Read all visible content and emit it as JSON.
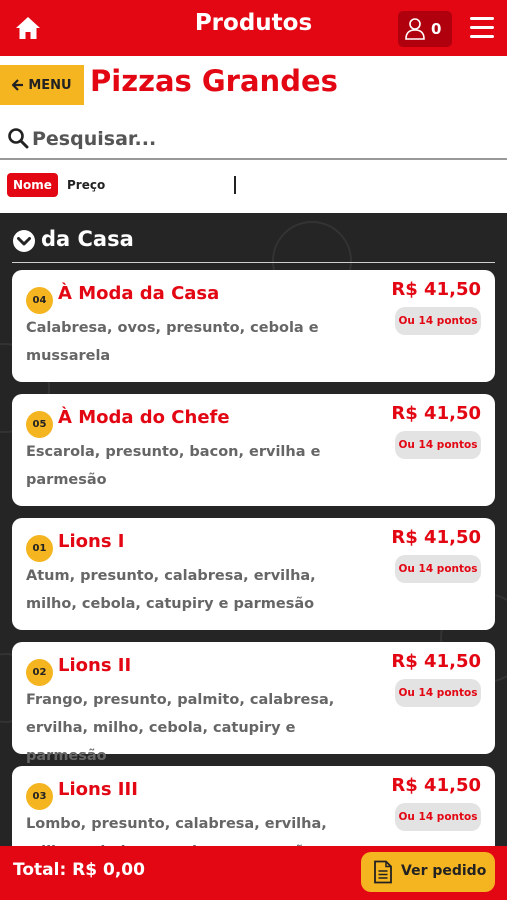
{
  "header": {
    "title": "Produtos",
    "cart_count": "0",
    "brand_color": "#e30613"
  },
  "menu_button": {
    "label": "MENU"
  },
  "page_title": "Pizzas Grandes",
  "search": {
    "placeholder": "Pesquisar...",
    "value": ""
  },
  "sort": {
    "active": "Nome",
    "other": "Preço"
  },
  "section": {
    "title": "da Casa"
  },
  "products": [
    {
      "code": "04",
      "name": "À Moda da Casa",
      "description": "Calabresa, ovos, presunto, cebola e mussarela",
      "price": "R$ 41,50",
      "points": "Ou 14 pontos"
    },
    {
      "code": "05",
      "name": "À Moda do Chefe",
      "description": "Escarola, presunto, bacon, ervilha e parmesão",
      "price": "R$ 41,50",
      "points": "Ou 14 pontos"
    },
    {
      "code": "01",
      "name": "Lions I",
      "description": "Atum, presunto, calabresa, ervilha, milho, cebola, catupiry e parmesão",
      "price": "R$ 41,50",
      "points": "Ou 14 pontos"
    },
    {
      "code": "02",
      "name": "Lions II",
      "description": "Frango, presunto, palmito, calabresa, ervilha, milho, cebola, catupiry e parmesão",
      "price": "R$ 41,50",
      "points": "Ou 14 pontos"
    },
    {
      "code": "03",
      "name": "Lions III",
      "description": "Lombo, presunto, calabresa, ervilha, milho, cebola, catupiry e parmesão",
      "price": "R$ 41,50",
      "points": "Ou 14 pontos"
    }
  ],
  "footer": {
    "total": "Total: R$ 0,00",
    "order_button": "Ver pedido"
  }
}
